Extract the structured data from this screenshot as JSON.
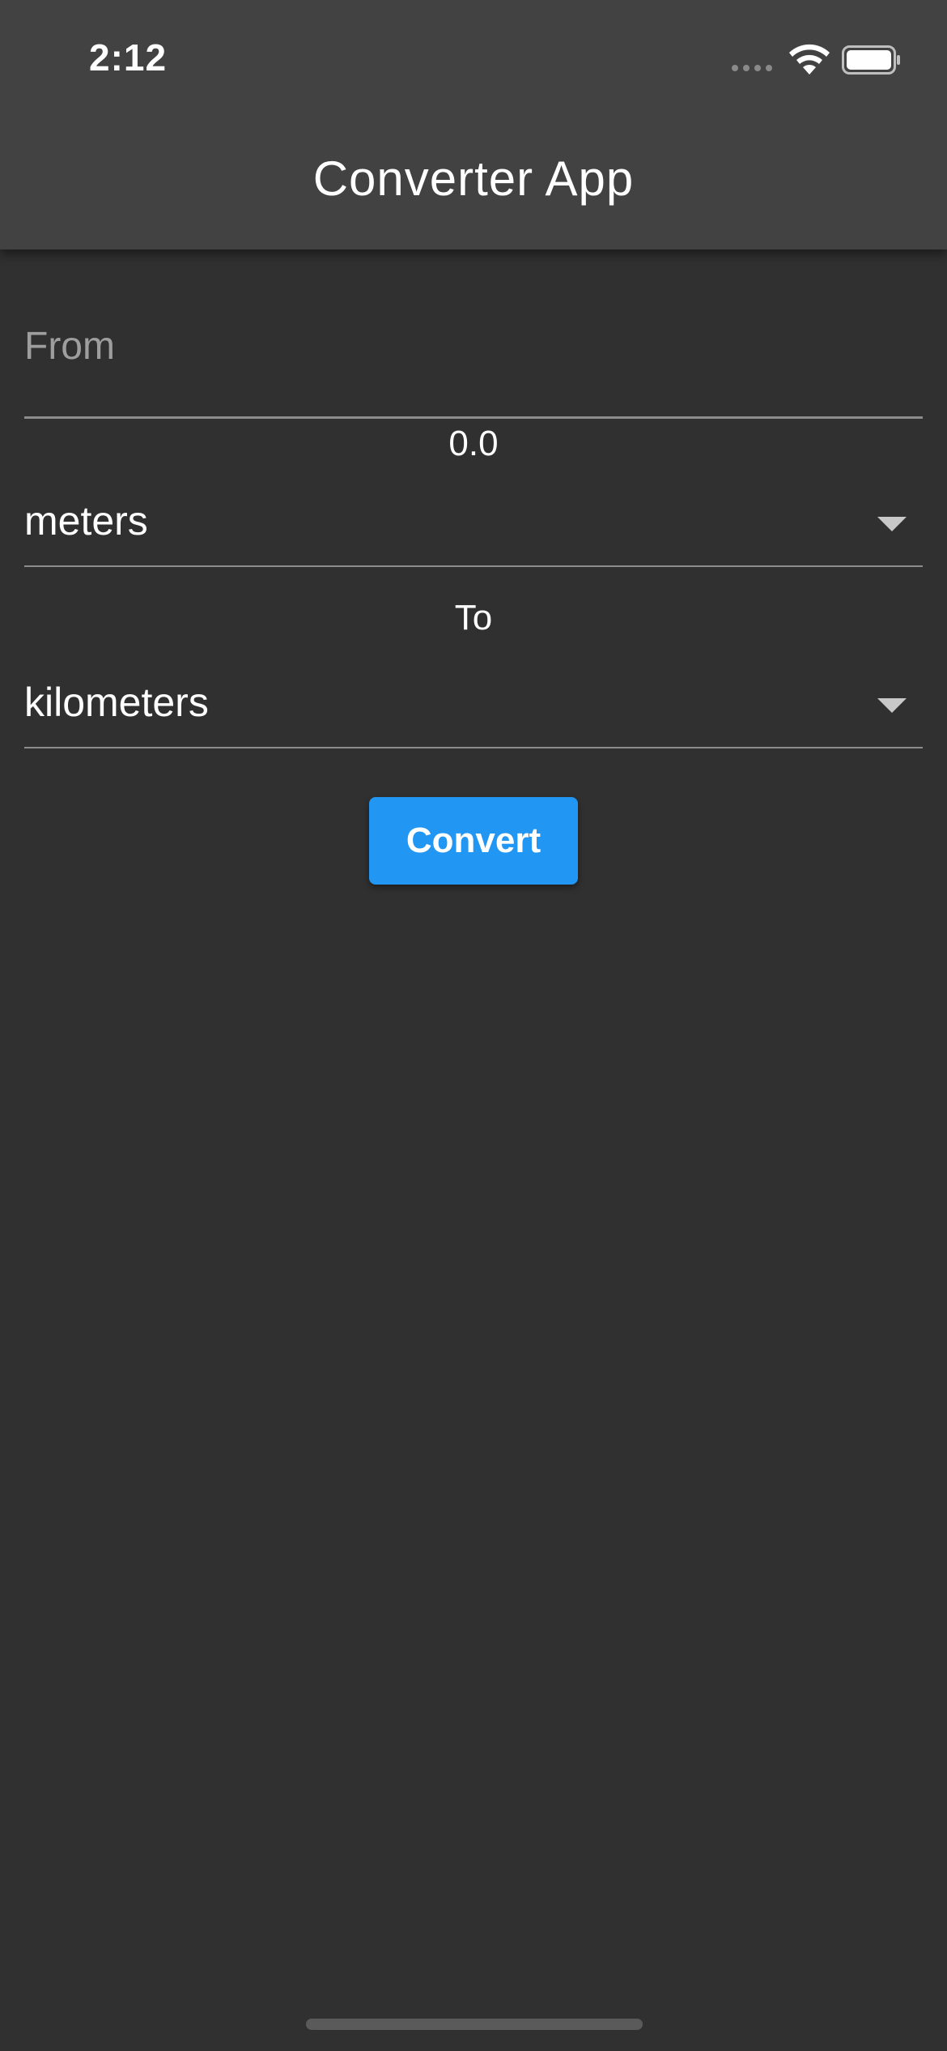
{
  "status_bar": {
    "time": "2:12",
    "icons": [
      "cellular-signal-icon",
      "wifi-icon",
      "battery-icon"
    ]
  },
  "app_bar": {
    "title": "Converter App"
  },
  "form": {
    "from_placeholder": "From",
    "from_value": "",
    "result_value": "0.0",
    "from_unit": "meters",
    "to_label": "To",
    "to_unit": "kilometers",
    "convert_label": "Convert"
  },
  "colors": {
    "background": "#303030",
    "app_bar": "#424242",
    "accent": "#2196f3",
    "hint_text": "#9e9e9e"
  }
}
